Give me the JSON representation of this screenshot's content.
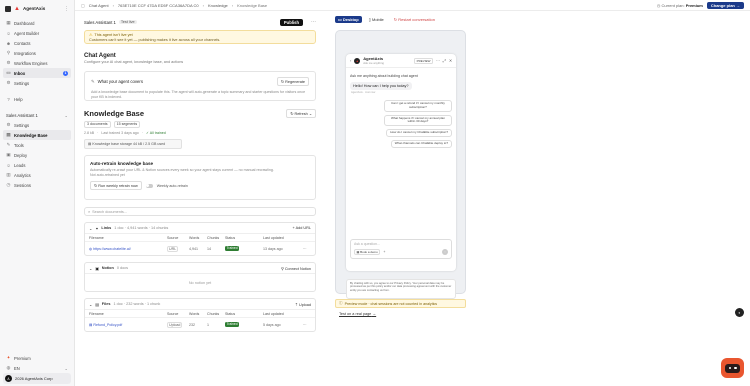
{
  "brand": {
    "name": "AgentAxis"
  },
  "sidebar": {
    "items": [
      {
        "label": "Dashboard",
        "icon": "grid-icon"
      },
      {
        "label": "Agent Builder",
        "icon": "bot-icon"
      },
      {
        "label": "Contacts",
        "icon": "users-icon"
      },
      {
        "label": "Integrations",
        "icon": "plug-icon"
      },
      {
        "label": "Workflow Engines",
        "icon": "gear-icon"
      },
      {
        "label": "Inbox",
        "icon": "inbox-icon",
        "badge": "1"
      },
      {
        "label": "Settings",
        "icon": "settings-icon"
      }
    ],
    "help": "Help",
    "agent_name": "Sales Assistant 1",
    "agent_items": [
      {
        "label": "Settings"
      },
      {
        "label": "Knowledge Base"
      },
      {
        "label": "Tools"
      },
      {
        "label": "Deploy"
      },
      {
        "label": "Leads"
      },
      {
        "label": "Analytics"
      },
      {
        "label": "Sessions"
      }
    ],
    "premium": "Premium",
    "language": "EN",
    "org": "2026 AgentAxis Corp"
  },
  "topbar": {
    "crumbs": [
      "Chat Agent",
      "763E710E CCF 47DA ED5F CCA36A7DA C0",
      "Knowledge"
    ],
    "current": "Knowledge Base",
    "plan_label": "Current plan:",
    "plan_name": "Premium",
    "change_plan": "Change plan"
  },
  "agent_bar": {
    "name": "Sales Assistant 1",
    "badge": "Test live",
    "publish": "Publish"
  },
  "alert": {
    "title": "This agent isn't live yet",
    "text": "Customers can't see it yet — publishing makes it live across all your channels."
  },
  "section": {
    "title": "Chat Agent",
    "subtitle": "Configure your AI chat agent, knowledge base, and actions"
  },
  "covers": {
    "title": "What your agent covers",
    "button": "Regenerate",
    "desc": "Add a knowledge base document to populate this. The agent will auto-generate a topic summary and starter questions for visitors once your KB is indexed."
  },
  "kb": {
    "title": "Knowledge Base",
    "refresh": "Refresh",
    "docs": "3 documents",
    "segments": "15 segments",
    "size": "2.8 kB",
    "trained": "Last trained 3 days ago",
    "status": "All trained",
    "storage": "Knowledge base storage   44 kB / 2.5 GB used"
  },
  "retrain": {
    "title": "Auto-retrain knowledge base",
    "desc": "Automatically re-crawl your URL & Notion sources every week so your agent stays current — no manual recrawling.",
    "status": "Not auto-retrained yet",
    "button": "Run weekly retrain now",
    "toggle_label": "Weekly auto-retrain"
  },
  "search": {
    "placeholder": "Search documents..."
  },
  "columns": [
    "Filename",
    "Source",
    "Words",
    "Chunks",
    "Status",
    "Last updated"
  ],
  "links": {
    "title": "Links",
    "meta": "1 doc · 4,941 words · 14 chunks",
    "action": "Add URL",
    "rows": [
      {
        "file": "https://www.chatelite.ai/",
        "source": "URL",
        "words": "4,941",
        "chunks": "14",
        "status": "Trained",
        "updated": "13 days ago"
      }
    ]
  },
  "notion": {
    "title": "Notion",
    "meta": "0 docs",
    "action": "Connect Notion",
    "empty": "No notion yet"
  },
  "files": {
    "title": "Files",
    "meta": "1 doc · 232 words · 1 chunk",
    "action": "Upload",
    "rows": [
      {
        "file": "Refund_Policy.pdf",
        "source": "Upload",
        "words": "232",
        "chunks": "1",
        "status": "Trained",
        "updated": "5 days ago"
      }
    ]
  },
  "preview": {
    "desktop": "Desktop",
    "mobile": "Mobile",
    "restart": "Restart conversation",
    "agent_name": "AgentAxis",
    "agent_sub": "Ask me anything",
    "preview_tag": "PREVIEW",
    "ask": "Ask me anything about building chat agent",
    "greeting": "Hello! How can I help you today?",
    "greeting_meta": "AgentAxis · Just now",
    "suggestions": [
      "Can I get a refund if I cancel my monthly subscription?",
      "What happens if I cancel my annual plan within 30 days?",
      "How do I cancel my ChatElite subscription?",
      "What channels can ChatElite deploy to?"
    ],
    "input_placeholder": "Ask a question...",
    "book_demo": "Book a demo",
    "legal": "By chatting with us, you agree to our Privacy Policy. Your personal data may be processed as per this policy and/or our data processing agreement with the customer entity you are contacting us from.",
    "note": "Preview mode · chat sessions are not counted in analytics",
    "test_link": "Test on a real page"
  }
}
